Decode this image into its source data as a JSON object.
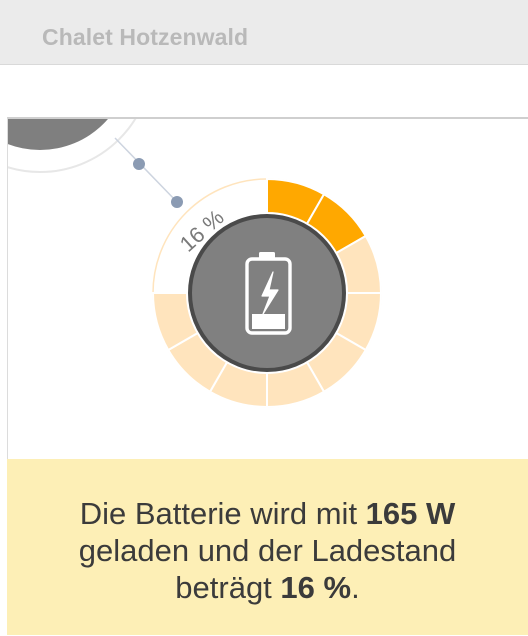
{
  "app": {
    "title": "Chalet Hotzenwald"
  },
  "battery": {
    "charge_percent": 16,
    "charge_label": "16 %",
    "icon": "battery-charging-icon",
    "ring_segments": 12,
    "filled_segments": 2,
    "colors": {
      "filled": "#ffa800",
      "empty": "#ffe4bd",
      "core": "#808080",
      "core_border": "#4a4a4a"
    }
  },
  "info": {
    "text_1": "Die Batterie wird mit ",
    "power": "165 W",
    "text_2": "geladen und der Ladestand",
    "text_3": "beträgt ",
    "percent": "16 %",
    "text_end": "."
  }
}
